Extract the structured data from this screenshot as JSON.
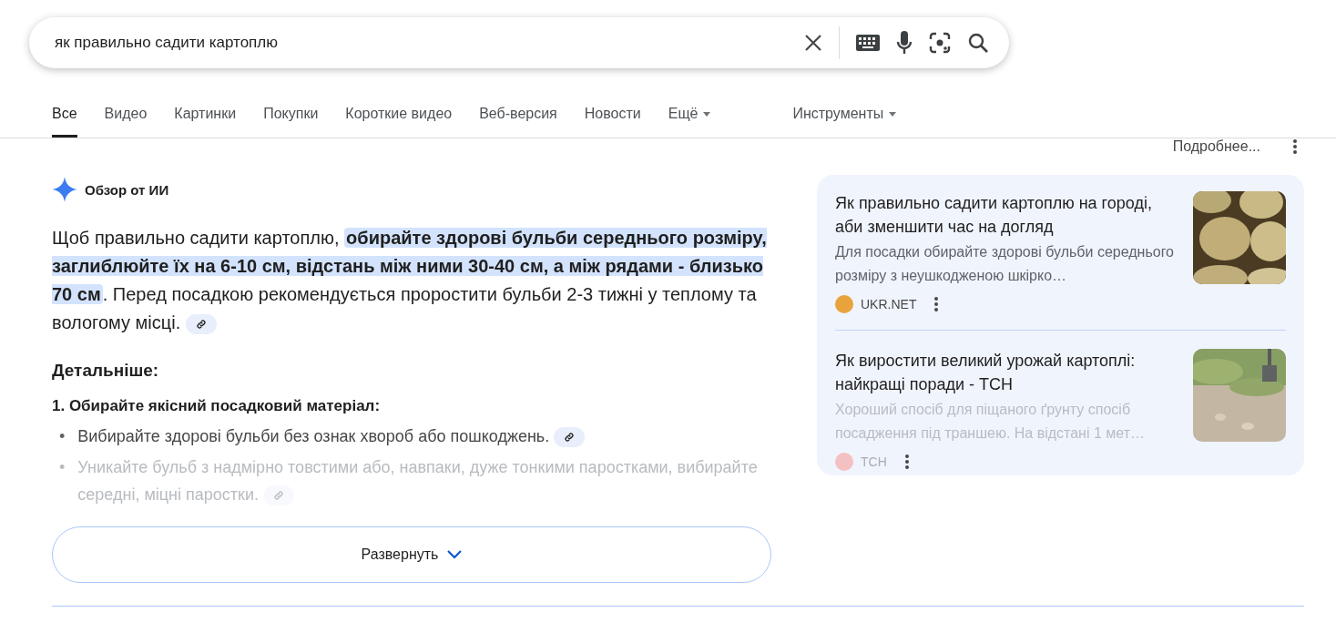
{
  "search": {
    "value": "як правильно садити картоплю"
  },
  "tabs": [
    {
      "label": "Все",
      "selected": true
    },
    {
      "label": "Видео",
      "selected": false
    },
    {
      "label": "Картинки",
      "selected": false
    },
    {
      "label": "Покупки",
      "selected": false
    },
    {
      "label": "Короткие видео",
      "selected": false
    },
    {
      "label": "Веб-версия",
      "selected": false
    },
    {
      "label": "Новости",
      "selected": false
    },
    {
      "label": "Ещё",
      "selected": false,
      "dropdown": true
    }
  ],
  "tools": {
    "label": "Инструменты"
  },
  "overview": {
    "title": "Обзор от ИИ",
    "more": "Подробнее...",
    "summary": "Щоб правильно садити картоплю, **обирайте здорові бульби середнього розміру, заглиблюйте їх на 6-10 см, відстань між ними 30-40 см, а між рядами - близько 70 см**. Перед посадкою рекомендується проростити бульби 2-3 тижні у теплому та вологому місці.",
    "details_heading": "Детальніше:",
    "step_heading": "1. Обирайте якісний посадковий матеріал:",
    "bullets": [
      {
        "marker": "•",
        "text": "Вибирайте здорові бульби без ознак хвороб або пошкоджень.",
        "faded": false
      },
      {
        "marker": "•",
        "text": "Уникайте бульб з надмірно товстими або, навпаки, дуже тонкими паростками, вибирайте середні, міцні паростки.",
        "faded": true
      }
    ],
    "expand": "Развернуть",
    "sources": [
      {
        "title": "Як правильно садити картоплю на городі, аби зменшити час на догляд",
        "snippet": "Для посадки обирайте здорові бульби середнього розміру з неушкодженою шкірко…",
        "site": "UKR.NET",
        "color": "#e8a33c",
        "faded": false
      },
      {
        "title": "Як виростити великий урожай картоплі: найкращі поради - ТСН",
        "snippet": "Хороший спосіб для піщаного ґрунту спосіб посадження під траншею. На відстані 1 мет…",
        "site": "ТСН",
        "color": "#f3c1c1",
        "faded": true
      }
    ]
  }
}
